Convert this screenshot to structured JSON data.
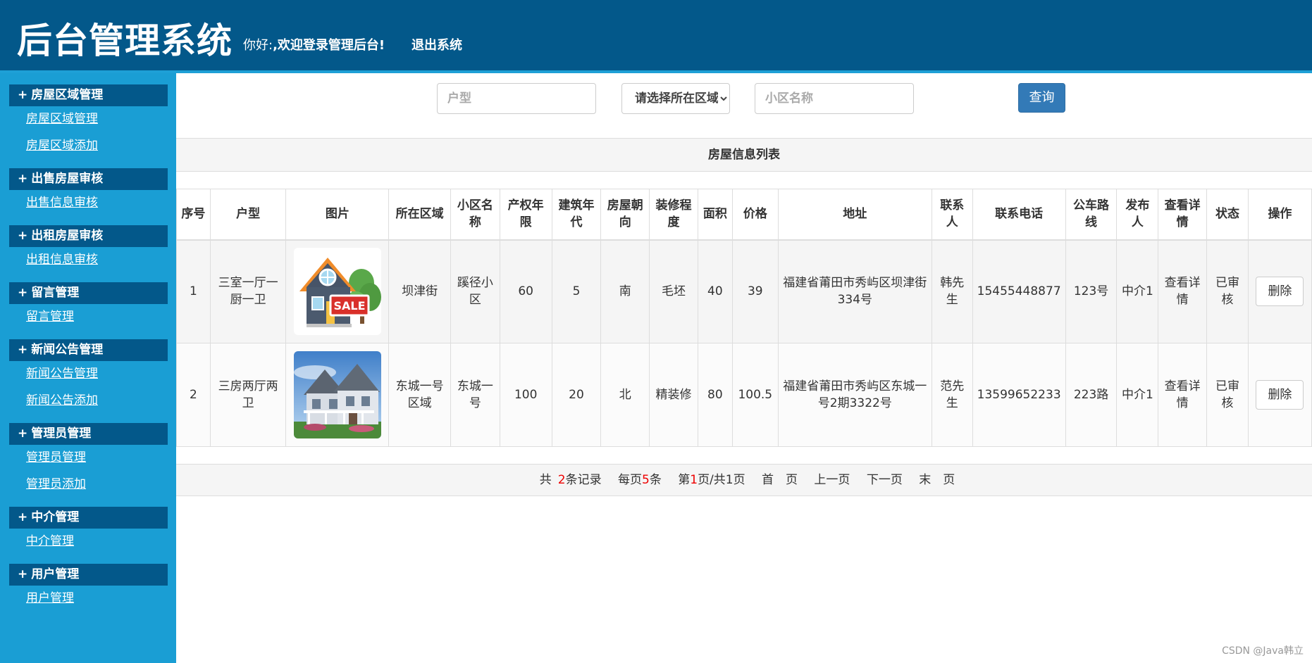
{
  "header": {
    "title": "后台管理系统",
    "greeting": "你好:",
    "welcome": ",欢迎登录管理后台!",
    "logout": "退出系统"
  },
  "sidebar": {
    "groups": [
      {
        "title": "房屋区域管理",
        "items": [
          "房屋区域管理",
          "房屋区域添加"
        ]
      },
      {
        "title": "出售房屋审核",
        "items": [
          "出售信息审核"
        ]
      },
      {
        "title": "出租房屋审核",
        "items": [
          "出租信息审核"
        ]
      },
      {
        "title": "留言管理",
        "items": [
          "留言管理"
        ]
      },
      {
        "title": "新闻公告管理",
        "items": [
          "新闻公告管理",
          "新闻公告添加"
        ]
      },
      {
        "title": "管理员管理",
        "items": [
          "管理员管理",
          "管理员添加"
        ]
      },
      {
        "title": "中介管理",
        "items": [
          "中介管理"
        ]
      },
      {
        "title": "用户管理",
        "items": [
          "用户管理"
        ]
      }
    ]
  },
  "search": {
    "type_placeholder": "户型",
    "region_selected": "请选择所在区域",
    "community_placeholder": "小区名称",
    "button": "查询"
  },
  "list": {
    "title": "房屋信息列表",
    "columns": [
      "序号",
      "户型",
      "图片",
      "所在区域",
      "小区名称",
      "产权年限",
      "建筑年代",
      "房屋朝向",
      "装修程度",
      "面积",
      "价格",
      "地址",
      "联系人",
      "联系电话",
      "公车路线",
      "发布人",
      "查看详情",
      "状态",
      "操作"
    ],
    "rows": [
      {
        "no": "1",
        "type": "三室一厅一厨一卫",
        "image": "house-sale-icon",
        "region": "坝津街",
        "community": "蹊径小区",
        "years": "60",
        "built": "5",
        "facing": "南",
        "decor": "毛坯",
        "area": "40",
        "price": "39",
        "address": "福建省莆田市秀屿区坝津街334号",
        "contact": "韩先生",
        "phone": "15455448877",
        "bus": "123号",
        "publisher": "中介1",
        "detail": "查看详情",
        "status": "已审核",
        "action": "删除"
      },
      {
        "no": "2",
        "type": "三房两厅两卫",
        "image": "house-photo",
        "region": "东城一号区域",
        "community": "东城一号",
        "years": "100",
        "built": "20",
        "facing": "北",
        "decor": "精装修",
        "area": "80",
        "price": "100.5",
        "address": "福建省莆田市秀屿区东城一号2期3322号",
        "contact": "范先生",
        "phone": "13599652233",
        "bus": "223路",
        "publisher": "中介1",
        "detail": "查看详情",
        "status": "已审核",
        "action": "删除"
      }
    ]
  },
  "pager": {
    "total_pre": "共",
    "total": "2",
    "total_post": "条记录",
    "per_pre": "每页",
    "per": "5",
    "per_post": "条",
    "page_pre": "第",
    "page": "1",
    "page_post": "页/共1页",
    "first": "首　页",
    "prev": "上一页",
    "next": "下一页",
    "last": "末　页"
  },
  "watermark": "CSDN @Java韩立",
  "colors": {
    "header": "#03588a",
    "sidebar": "#1a9ed4",
    "button": "#337ab7",
    "highlight": "#e00000"
  }
}
